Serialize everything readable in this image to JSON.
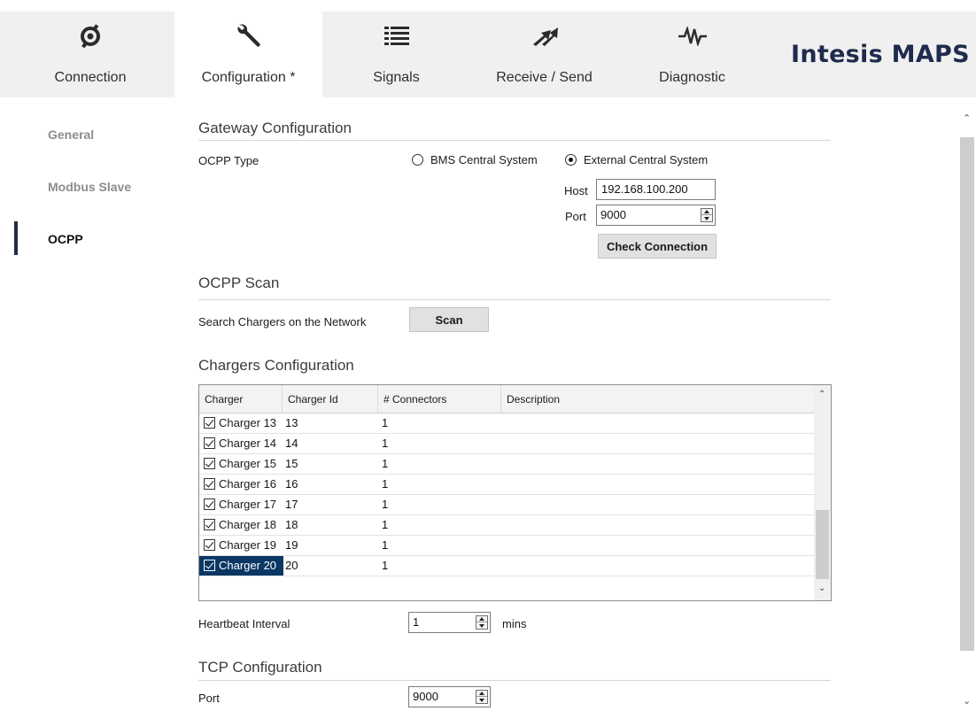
{
  "tabs": [
    {
      "id": "connection",
      "label": "Connection",
      "icon": "plug-icon"
    },
    {
      "id": "configuration",
      "label": "Configuration *",
      "icon": "wrench-icon",
      "active": true
    },
    {
      "id": "signals",
      "label": "Signals",
      "icon": "list-icon"
    },
    {
      "id": "receive_send",
      "label": "Receive / Send",
      "icon": "transfer-arrows-icon"
    },
    {
      "id": "diagnostic",
      "label": "Diagnostic",
      "icon": "pulse-icon"
    }
  ],
  "brand": "Intesis MAPS",
  "nav": {
    "items": [
      {
        "label": "General"
      },
      {
        "label": "Modbus Slave"
      },
      {
        "label": "OCPP",
        "active": true
      }
    ]
  },
  "gateway": {
    "title": "Gateway Configuration",
    "ocpp_type_label": "OCPP Type",
    "option_bms": "BMS Central System",
    "option_external": "External Central System",
    "selected": "External Central System",
    "host_label": "Host",
    "host_value": "192.168.100.200",
    "port_label": "Port",
    "port_value": "9000",
    "check_button": "Check Connection"
  },
  "scan": {
    "title": "OCPP Scan",
    "label": "Search Chargers on the Network",
    "button": "Scan"
  },
  "chargers": {
    "title": "Chargers Configuration",
    "columns": [
      "Charger",
      "Charger Id",
      "# Connectors",
      "Description"
    ],
    "rows": [
      {
        "charger": "Charger 13",
        "id": "13",
        "connectors": "1",
        "description": "",
        "checked": true
      },
      {
        "charger": "Charger 14",
        "id": "14",
        "connectors": "1",
        "description": "",
        "checked": true
      },
      {
        "charger": "Charger 15",
        "id": "15",
        "connectors": "1",
        "description": "",
        "checked": true
      },
      {
        "charger": "Charger 16",
        "id": "16",
        "connectors": "1",
        "description": "",
        "checked": true
      },
      {
        "charger": "Charger 17",
        "id": "17",
        "connectors": "1",
        "description": "",
        "checked": true
      },
      {
        "charger": "Charger 18",
        "id": "18",
        "connectors": "1",
        "description": "",
        "checked": true
      },
      {
        "charger": "Charger 19",
        "id": "19",
        "connectors": "1",
        "description": "",
        "checked": true
      },
      {
        "charger": "Charger 20",
        "id": "20",
        "connectors": "1",
        "description": "",
        "checked": true,
        "selected": true
      }
    ]
  },
  "heartbeat": {
    "label": "Heartbeat Interval",
    "value": "1",
    "unit": "mins"
  },
  "tcp": {
    "title": "TCP Configuration",
    "port_label": "Port",
    "port_value": "9000"
  },
  "colors": {
    "brand": "#1f2b4d",
    "selection": "#0a3764",
    "tabbar": "#f0f0f0"
  }
}
